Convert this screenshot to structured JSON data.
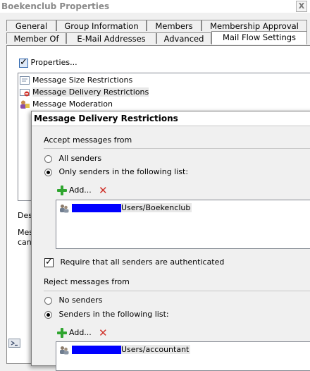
{
  "window": {
    "title": "Boekenclub Properties",
    "close_glyph": "X"
  },
  "tabs_row1": [
    "General",
    "Group Information",
    "Members",
    "Membership Approval"
  ],
  "tabs_row2": [
    "Member Of",
    "E-Mail Addresses",
    "Advanced",
    "Mail Flow Settings"
  ],
  "properties_label": "Properties...",
  "settings_list": [
    {
      "label": "Message Size Restrictions",
      "icon": "size-restrictions-icon"
    },
    {
      "label": "Message Delivery Restrictions",
      "icon": "delivery-restrictions-icon",
      "selected": true
    },
    {
      "label": "Message Moderation",
      "icon": "moderation-icon"
    }
  ],
  "description": {
    "label": "Des",
    "text_line1": "Mes",
    "text_line2": "can"
  },
  "dialog": {
    "title": "Message Delivery Restrictions",
    "accept": {
      "heading": "Accept messages from",
      "all_senders": "All senders",
      "only_senders": "Only senders in the following list:",
      "selected": "only_senders",
      "add_label": "Add...",
      "entries": [
        "Users/Boekenclub"
      ]
    },
    "require_auth": {
      "label": "Require that all senders are authenticated",
      "checked": true
    },
    "reject": {
      "heading": "Reject messages from",
      "no_senders": "No senders",
      "senders_list": "Senders in the following list:",
      "selected": "senders_list",
      "add_label": "Add...",
      "entries": [
        "Users/accountant"
      ]
    }
  },
  "colors": {
    "redaction": "#0000ff",
    "add_green": "#2fa52f",
    "remove_red": "#d0322a"
  }
}
